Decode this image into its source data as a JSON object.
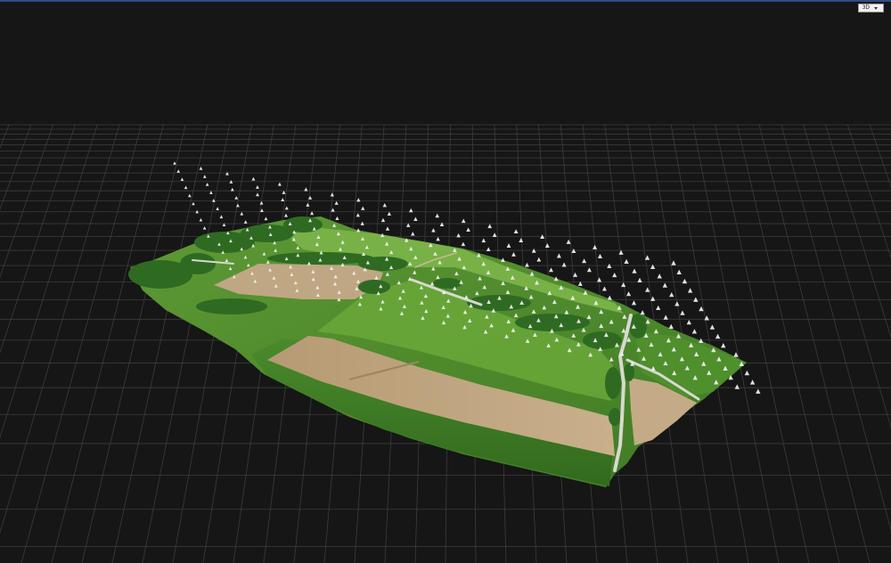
{
  "viewer": {
    "view_mode_label": "3D",
    "view_mode_icon": "chevron-down-icon",
    "colors": {
      "background": "#161616",
      "grid": "#3c3c3c",
      "camera_marker": "#f2f2f2",
      "accent_edge": "#2b4e8a"
    }
  }
}
